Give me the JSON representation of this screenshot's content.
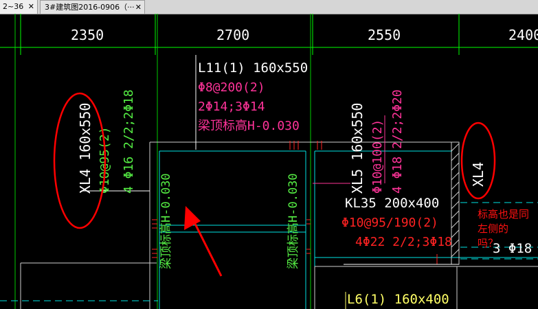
{
  "tabs": [
    {
      "label": "2~36",
      "close": "✕"
    },
    {
      "label": "3#建筑图2016-0906（···",
      "close": "✕"
    }
  ],
  "dimensions": [
    "2350",
    "2700",
    "2550",
    "2400"
  ],
  "beams": {
    "l11": {
      "name": "L11(1) 160x550",
      "stirrup": "Φ8@200(2)",
      "bars": "2Φ14;3Φ14",
      "level": "梁顶标高H-0.030"
    },
    "xl4_left": {
      "name": "XL4 160x550",
      "stirrup": "Φ10@95(2)",
      "bars": "4 Φ16 2/2;2Φ18"
    },
    "xl5": {
      "name": "XL5 160x550",
      "stirrup": "Φ10@100(2)",
      "bars": "4 Φ18 2/2;2Φ20"
    },
    "xl4_right": {
      "name": "XL4"
    },
    "kl35": {
      "name": "KL35 200x400",
      "stirrup": "Φ10@95/190(2)",
      "bars": "4Φ22 2/2;3Φ18"
    },
    "level_left": "梁顶标高H-0.030",
    "level_mid": "梁顶标高H-0.030",
    "partial_bars": "3 Φ18",
    "l6": {
      "name": "L6(1) 160x400"
    }
  },
  "annotation": {
    "line1": "标高也是同",
    "line2": "左侧的",
    "line3": "吗？"
  },
  "colors": {
    "background": "#000000",
    "grid": "#00ff00",
    "dimension_text": "#ffffff",
    "beam_magenta": "#ff3399",
    "beam_green": "#55ee44",
    "beam_yellow": "#ffff66",
    "beam_red": "#ff2222",
    "cyan": "#00e5e5",
    "mark_red": "#ff0000"
  }
}
